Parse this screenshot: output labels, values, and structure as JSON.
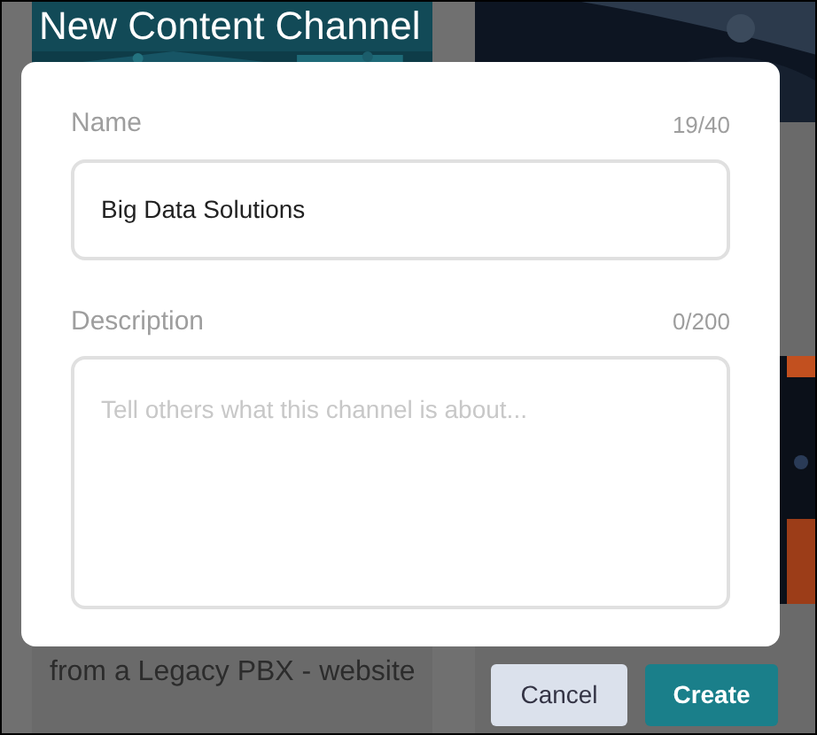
{
  "background": {
    "title": "New Content Channel",
    "card_text": "from a Legacy PBX - website"
  },
  "dialog": {
    "fields": [
      {
        "kind": "input",
        "label": "Name",
        "counter": "19/40",
        "value": "Big Data Solutions"
      },
      {
        "kind": "textarea",
        "label": "Description",
        "counter": "0/200",
        "placeholder": "Tell others what this channel is about..."
      }
    ]
  },
  "buttons": [
    {
      "label": "Cancel",
      "kind": "secondary"
    },
    {
      "label": "Create",
      "kind": "primary"
    }
  ]
}
